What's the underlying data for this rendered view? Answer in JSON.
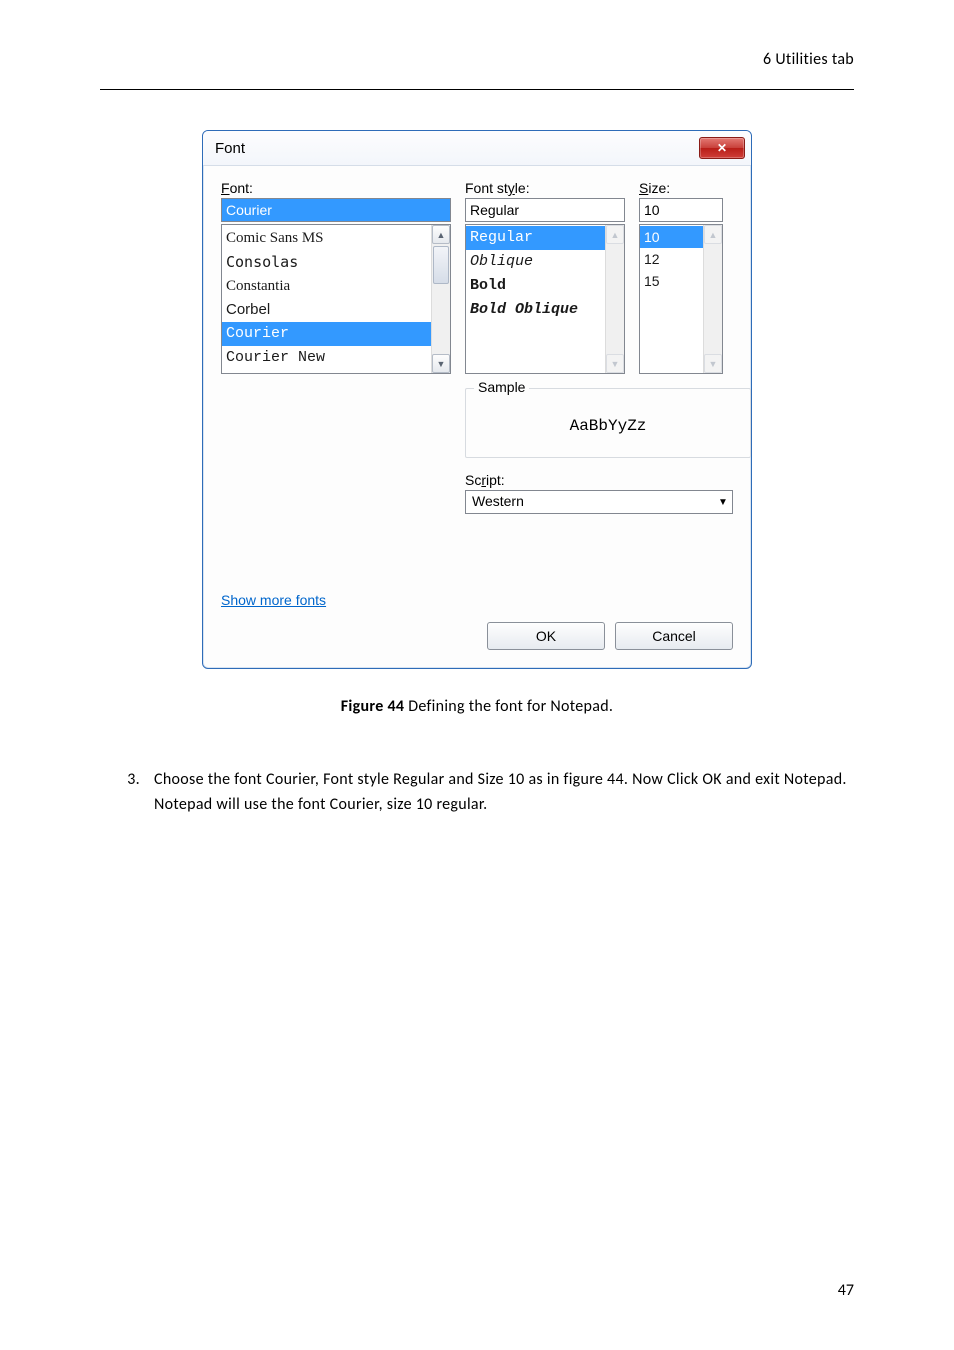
{
  "header": {
    "section": "6 Utilities tab"
  },
  "dialog": {
    "title": "Font",
    "labels": {
      "font_pre": "F",
      "font_post": "ont:",
      "style_pre": "Font st",
      "style_mid": "y",
      "style_post": "le:",
      "size_pre": "S",
      "size_post": "ize:",
      "sample": "Sample",
      "script_pre": "Sc",
      "script_mid": "r",
      "script_post": "ipt:"
    },
    "font": {
      "value": "Courier",
      "selected_index": 4,
      "items": [
        "Comic Sans MS",
        "Consolas",
        "Constantia",
        "Corbel",
        "Courier",
        "Courier New"
      ]
    },
    "style": {
      "value": "Regular",
      "selected_index": 0,
      "items": [
        "Regular",
        "Oblique",
        "Bold",
        "Bold Oblique"
      ]
    },
    "size": {
      "value": "10",
      "selected_index": 0,
      "items": [
        "10",
        "12",
        "15"
      ]
    },
    "sample_text": "AaBbYyZz",
    "script": {
      "value": "Western"
    },
    "link": "Show more fonts",
    "buttons": {
      "ok": "OK",
      "cancel": "Cancel"
    }
  },
  "caption": {
    "label": "Figure 44",
    "text": " Defining the font for Notepad."
  },
  "step": {
    "num": "3.",
    "text": "Choose the font Courier, Font style Regular and Size 10 as in figure 44. Now Click OK and exit Notepad. Notepad will use the font Courier, size 10 regular."
  },
  "page_number": "47"
}
